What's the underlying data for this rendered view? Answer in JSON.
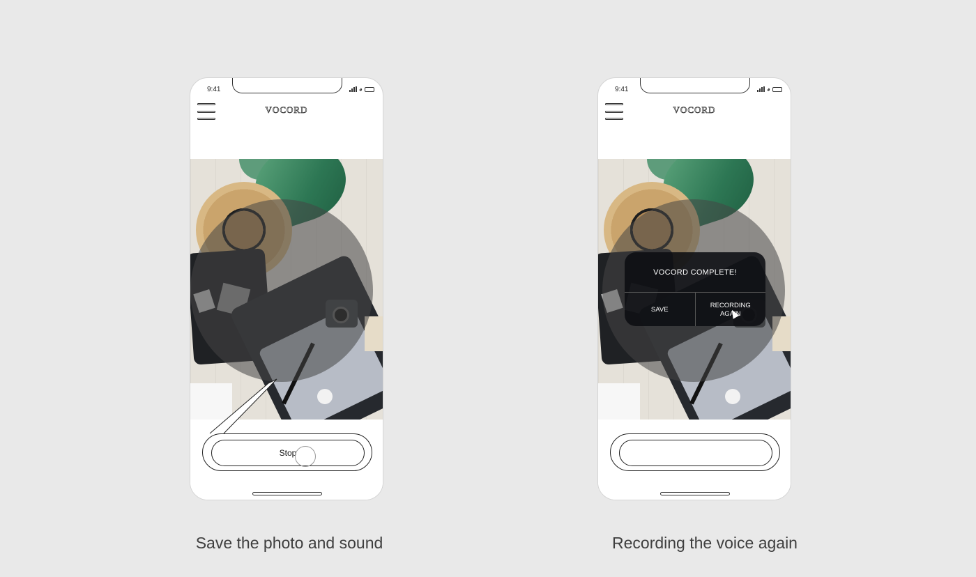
{
  "screens": [
    {
      "status_time": "9:41",
      "brand": "VOCORD",
      "stop_button_label": "Stop",
      "caption": "Save the photo and sound"
    },
    {
      "status_time": "9:41",
      "brand": "VOCORD",
      "dialog": {
        "title": "VOCORD COMPLETE!",
        "save_label": "SAVE",
        "recording_again_label": "RECORDING AGAIN"
      },
      "caption": "Recording the voice again"
    }
  ]
}
